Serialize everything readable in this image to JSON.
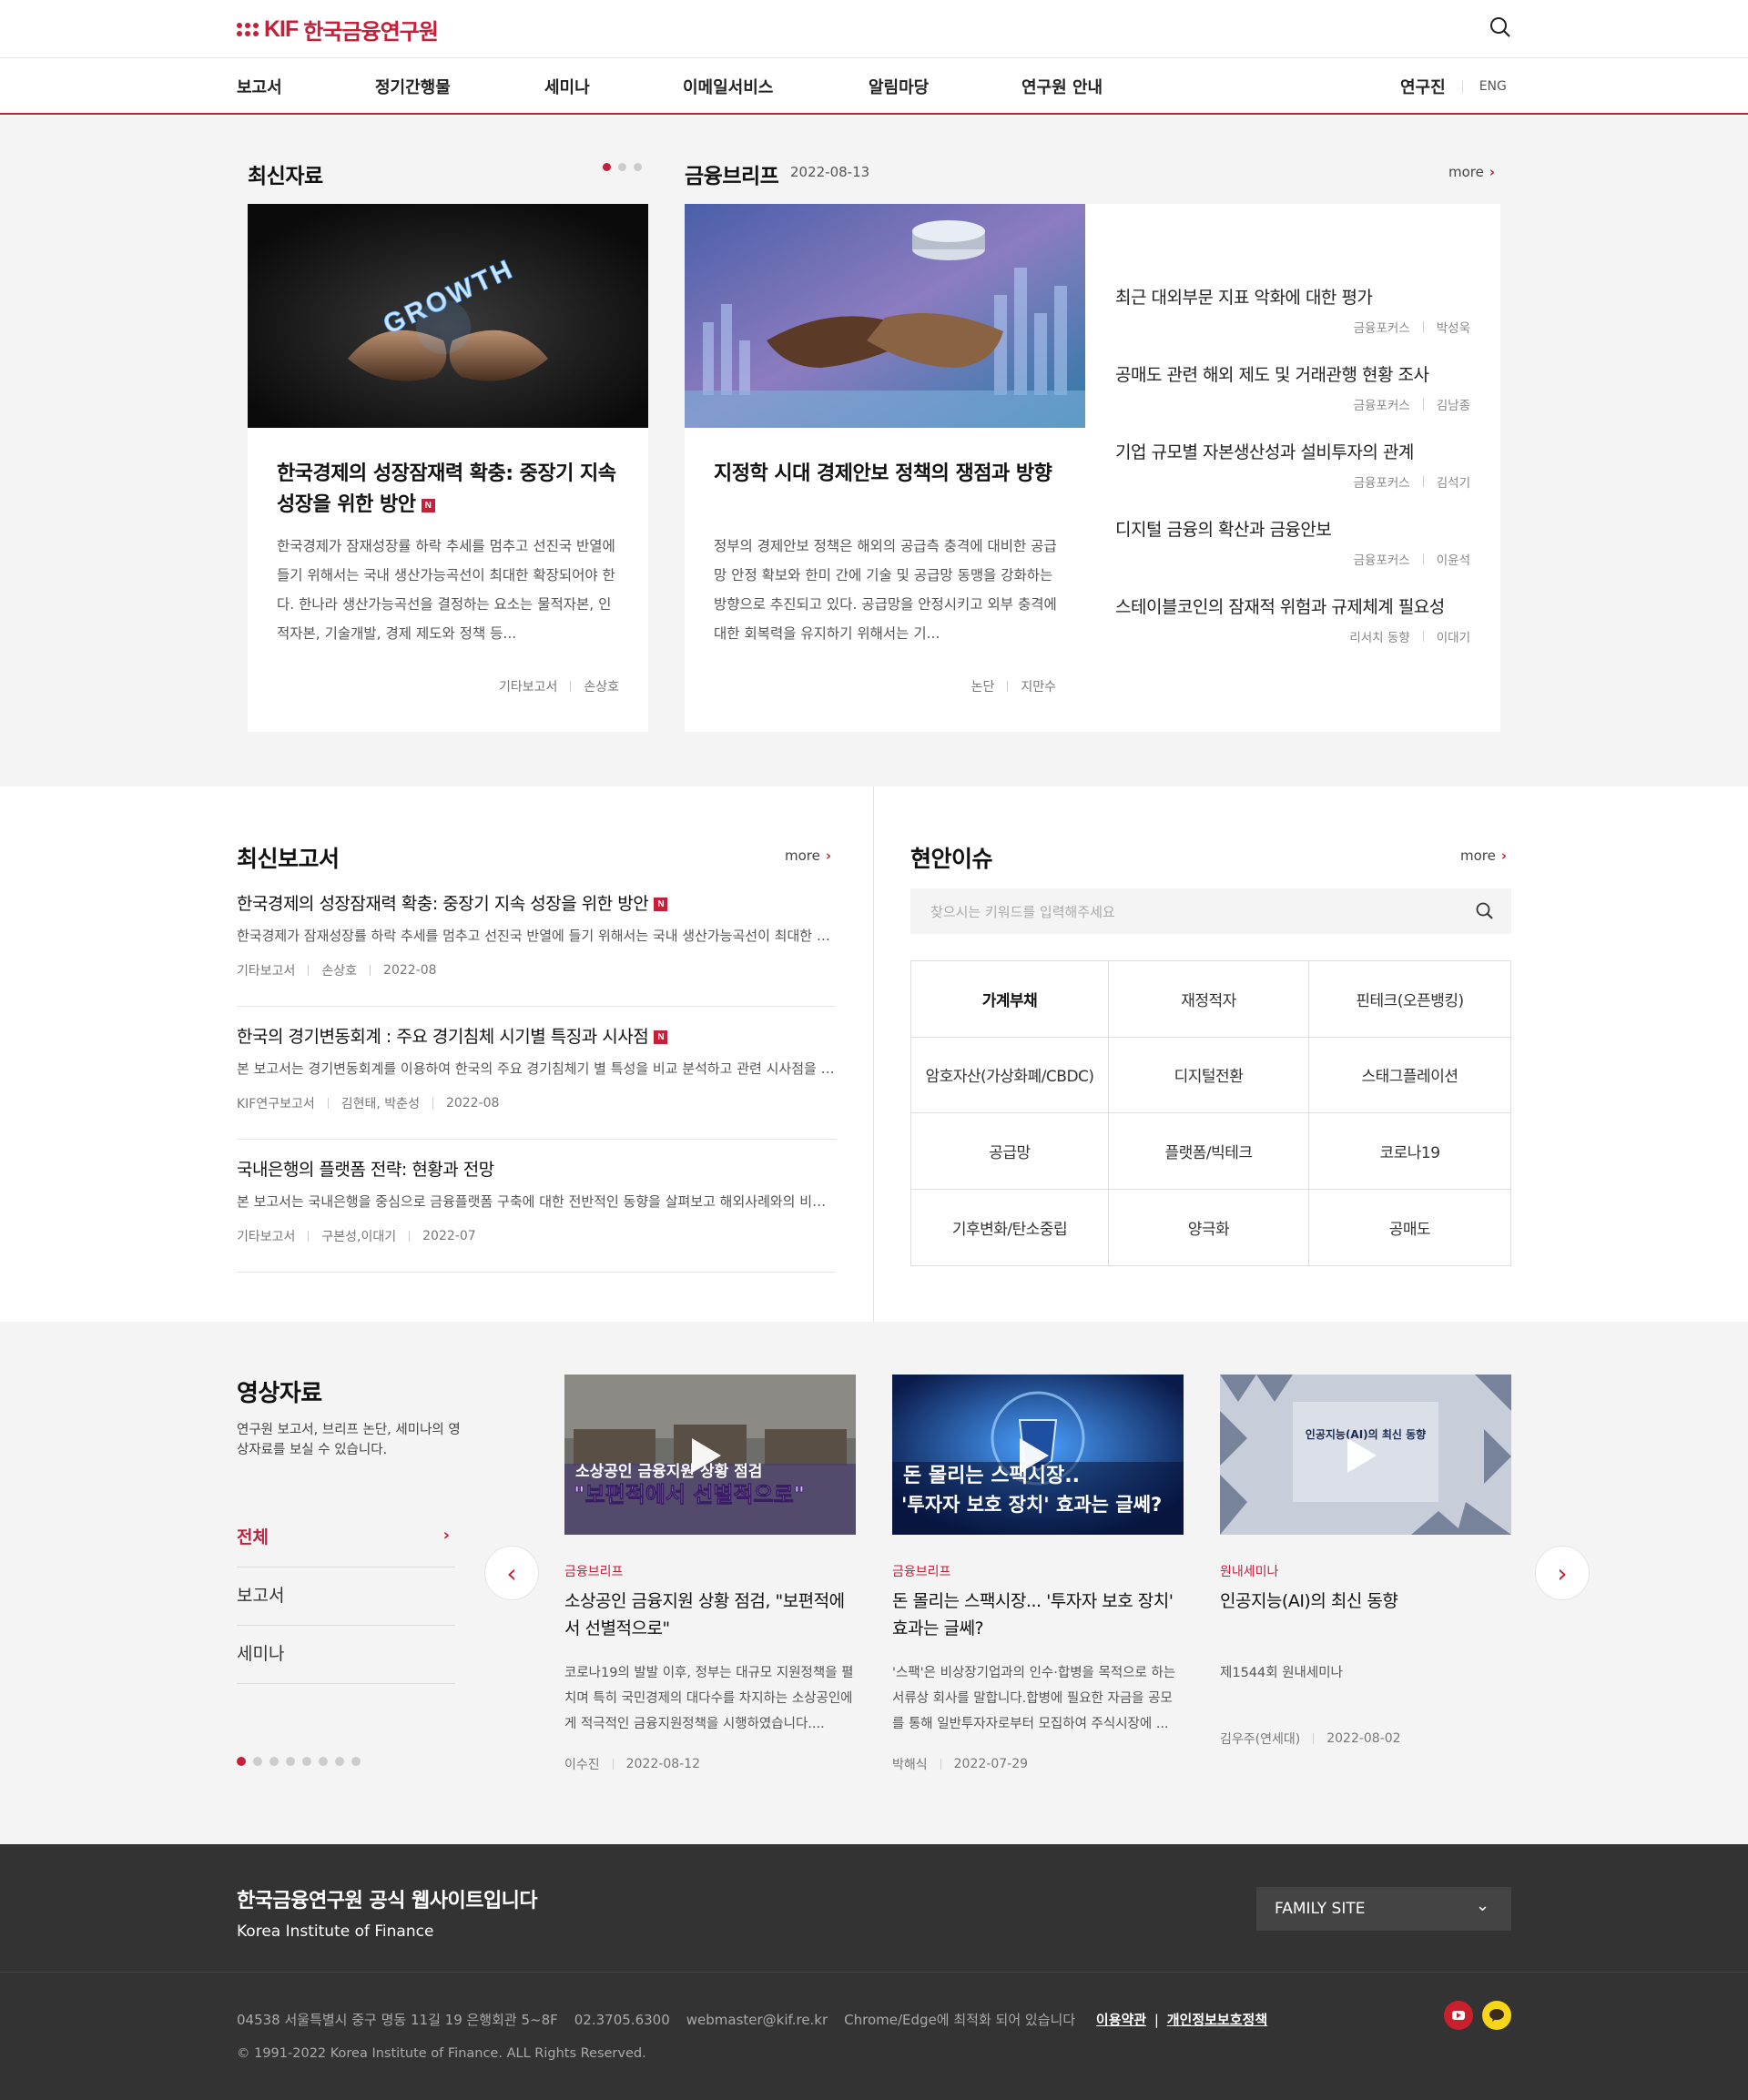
{
  "header": {
    "logo_text": "KIF",
    "logo_name": "한국금융연구원",
    "nav": [
      "보고서",
      "정기간행물",
      "세미나",
      "이메일서비스",
      "알림마당",
      "연구원 안내"
    ],
    "staff": "연구진",
    "eng": "ENG"
  },
  "latest": {
    "title": "최신자료",
    "card1": {
      "thumb_text": "GROWTH",
      "title": "한국경제의 성장잠재력 확충: 중장기 지속 성장을 위한 방안",
      "badge": "N",
      "desc": "한국경제가 잠재성장률 하락 추세를 멈추고 선진국 반열에 들기 위해서는 국내 생산가능곡선이 최대한 확장되어야 한다. 한나라 생산가능곡선을 결정하는 요소는 물적자본, 인적자본, 기술개발, 경제 제도와 정책 등...",
      "category": "기타보고서",
      "author": "손상호"
    }
  },
  "brief": {
    "title": "금융브리프",
    "date": "2022-08-13",
    "more": "more",
    "card": {
      "title": "지정학 시대 경제안보 정책의 쟁점과 방향",
      "desc": "정부의 경제안보 정책은 해외의 공급측 충격에 대비한 공급망 안정 확보와 한미 간에 기술 및 공급망 동맹을 강화하는 방향으로 추진되고 있다. 공급망을 안정시키고 외부 충격에 대한 회복력을 유지하기 위해서는 기...",
      "category": "논단",
      "author": "지만수"
    },
    "list": [
      {
        "title": "최근 대외부문 지표 악화에 대한 평가",
        "category": "금융포커스",
        "author": "박성욱"
      },
      {
        "title": "공매도 관련 해외 제도 및 거래관행 현황 조사",
        "category": "금융포커스",
        "author": "김남종"
      },
      {
        "title": "기업 규모별 자본생산성과 설비투자의 관계",
        "category": "금융포커스",
        "author": "김석기"
      },
      {
        "title": "디지털 금융의 확산과 금융안보",
        "category": "금융포커스",
        "author": "이윤석"
      },
      {
        "title": "스테이블코인의 잠재적 위험과 규제체계 필요성",
        "category": "리서치 동향",
        "author": "이대기"
      }
    ]
  },
  "reports": {
    "title": "최신보고서",
    "more": "more",
    "items": [
      {
        "title": "한국경제의 성장잠재력 확충: 중장기 지속 성장을 위한 방안",
        "badge": "N",
        "desc": "한국경제가 잠재성장률 하락 추세를 멈추고 선진국 반열에 들기 위해서는 국내 생산가능곡선이 최대한 확...",
        "category": "기타보고서",
        "author": "손상호",
        "date": "2022-08"
      },
      {
        "title": "한국의 경기변동회계 : 주요 경기침체 시기별 특징과 시사점",
        "badge": "N",
        "desc": "본 보고서는 경기변동회계를 이용하여 한국의 주요 경기침체기 별 특성을 비교 분석하고 관련 시사점을 도...",
        "category": "KIF연구보고서",
        "author": "김현태, 박춘성",
        "date": "2022-08"
      },
      {
        "title": "국내은행의 플랫폼 전략: 현황과 전망",
        "badge": "",
        "desc": "본 보고서는 국내은행을 중심으로 금융플랫폼 구축에 대한 전반적인 동향을 살펴보고 해외사례와의 비교...",
        "category": "기타보고서",
        "author": "구본성,이대기",
        "date": "2022-07"
      }
    ]
  },
  "issues": {
    "title": "현안이슈",
    "more": "more",
    "search_placeholder": "찾으시는 키워드를 입력해주세요",
    "keywords": [
      "가계부채",
      "재정적자",
      "핀테크(오픈뱅킹)",
      "암호자산(가상화폐/CBDC)",
      "디지털전환",
      "스태그플레이션",
      "공급망",
      "플랫폼/빅테크",
      "코로나19",
      "기후변화/탄소중립",
      "양극화",
      "공매도"
    ],
    "selected": "가계부채"
  },
  "videos": {
    "title": "영상자료",
    "desc": "연구원 보고서, 브리프 논단, 세미나의 영상자료를 보실 수 있습니다.",
    "categories": [
      "전체",
      "보고서",
      "세미나"
    ],
    "active_category": "전체",
    "active_page": 1,
    "pages": 8,
    "items": [
      {
        "thumb_line1": "소상공인 금융지원 상황 점검",
        "thumb_line2": "\"보편적에서 선별적으로\"",
        "category": "금융브리프",
        "title": "소상공인 금융지원 상황 점검, \"보편적에서 선별적으로\"",
        "desc": "코로나19의 발발 이후, 정부는 대규모 지원정책을 펼치며 특히 국민경제의 대다수를 차지하는 소상공인에게 적극적인 금융지원정책을 시행하였습니다....",
        "author": "이수진",
        "date": "2022-08-12"
      },
      {
        "thumb_line1": "돈 몰리는 스팩시장..",
        "thumb_line2": "'투자자 보호 장치' 효과는 글쎄?",
        "category": "금융브리프",
        "title": "돈 몰리는 스팩시장... '투자자 보호 장치' 효과는 글쎄?",
        "desc": "'스팩'은 비상장기업과의 인수·합병을 목적으로 하는 서류상 회사를 말합니다.합병에 필요한 자금을 공모를 통해 일반투자자로부터 모집하여 주식시장에 ...",
        "author": "박해식",
        "date": "2022-07-29"
      },
      {
        "thumb_line1": "인공지능(AI)의 최신 동향",
        "thumb_line2": "",
        "category": "원내세미나",
        "title": "인공지능(AI)의 최신 동향",
        "desc": "제1544회 원내세미나",
        "author": "김우주(연세대)",
        "date": "2022-08-02"
      }
    ]
  },
  "footer": {
    "title": "한국금융연구원 공식 웹사이트입니다",
    "subtitle": "Korea Institute of Finance",
    "family_site": "FAMILY SITE",
    "address": "04538 서울특별시 중구 명동 11길 19 은행회관 5~8F",
    "phone": "02.3705.6300",
    "email": "webmaster@kif.re.kr",
    "browser_note": "Chrome/Edge에 최적화 되어 있습니다",
    "terms": "이용약관",
    "privacy": "개인정보보호정책",
    "copyright": "© 1991-2022 Korea Institute of Finance. ALL Rights Reserved."
  },
  "colors": {
    "accent": "#c5203a",
    "footer_bg": "#333333",
    "section_bg": "#f4f4f4"
  }
}
